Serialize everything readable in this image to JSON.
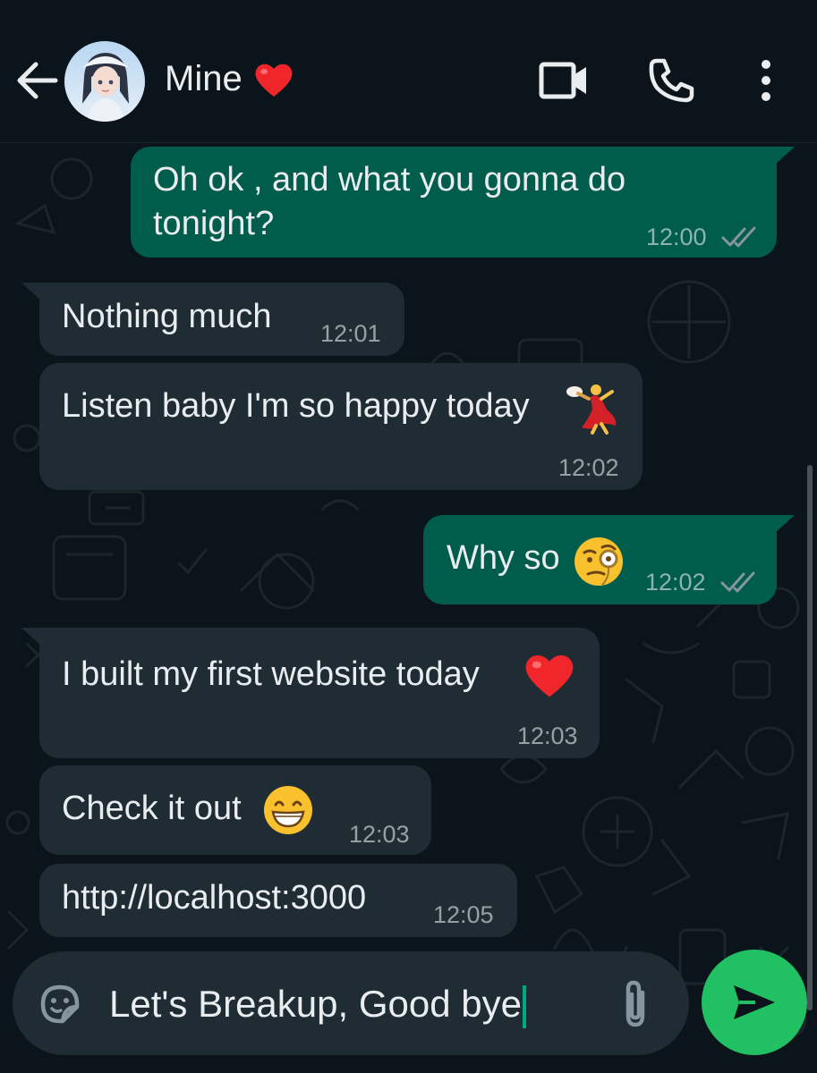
{
  "header": {
    "contact_name": "Mine",
    "name_emoji": "heart-emoji",
    "icons": [
      "back-arrow-icon",
      "avatar",
      "video-call-icon",
      "voice-call-icon",
      "more-options-icon"
    ]
  },
  "messages": [
    {
      "direction": "outgoing",
      "lines": [
        "Oh ok , and what you gonna do",
        "tonight?"
      ],
      "time": "12:00",
      "status": "read"
    },
    {
      "direction": "incoming",
      "lines": [
        "Nothing much"
      ],
      "time": "12:01"
    },
    {
      "direction": "incoming",
      "lines": [
        "Listen baby I'm so happy today"
      ],
      "emoji": "dancer-emoji",
      "time": "12:02"
    },
    {
      "direction": "outgoing",
      "lines": [
        "Why so"
      ],
      "emoji": "monocle-face-emoji",
      "time": "12:02",
      "status": "read"
    },
    {
      "direction": "incoming",
      "lines": [
        "I built my first website today"
      ],
      "emoji": "heart-emoji",
      "time": "12:03"
    },
    {
      "direction": "incoming",
      "lines": [
        "Check it out"
      ],
      "emoji": "grinning-face-emoji",
      "time": "12:03"
    },
    {
      "direction": "incoming",
      "lines": [
        "http://localhost:3000"
      ],
      "time": "12:05"
    }
  ],
  "composer": {
    "value": "Let's Breakup, Good bye",
    "icons": [
      "sticker-icon",
      "attach-icon",
      "send-icon"
    ]
  },
  "colors": {
    "background": "#0b141a",
    "incoming_bubble": "#202c33",
    "outgoing_bubble": "#005c4b",
    "send_button": "#21c063",
    "read_ticks": "#8696a0"
  }
}
